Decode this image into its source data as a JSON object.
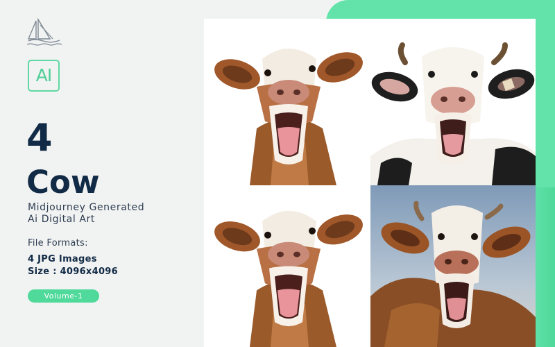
{
  "product": {
    "count": "4",
    "title": "Cow",
    "subtitle_line1": "Midjourney Generated",
    "subtitle_line2": "Ai Digital Art",
    "formats_label": "File Formats:",
    "formats_line1": "4 JPG Images",
    "formats_line2": "Size : 4096x4096",
    "volume": "Volume-1",
    "badge_text": "AI"
  },
  "icons": {
    "logo": "sailboat-logo-icon",
    "badge": "ai-badge-icon"
  },
  "images": [
    {
      "name": "cow-image-brown-1",
      "description": "brown cow"
    },
    {
      "name": "cow-image-black-white",
      "description": "black and white cow"
    },
    {
      "name": "cow-image-brown-2",
      "description": "brown cow"
    },
    {
      "name": "cow-image-brown-sky",
      "description": "brown cow"
    }
  ],
  "colors": {
    "accent_green": "#63e3aa",
    "navy": "#112a45",
    "background": "#f1f2f2"
  }
}
